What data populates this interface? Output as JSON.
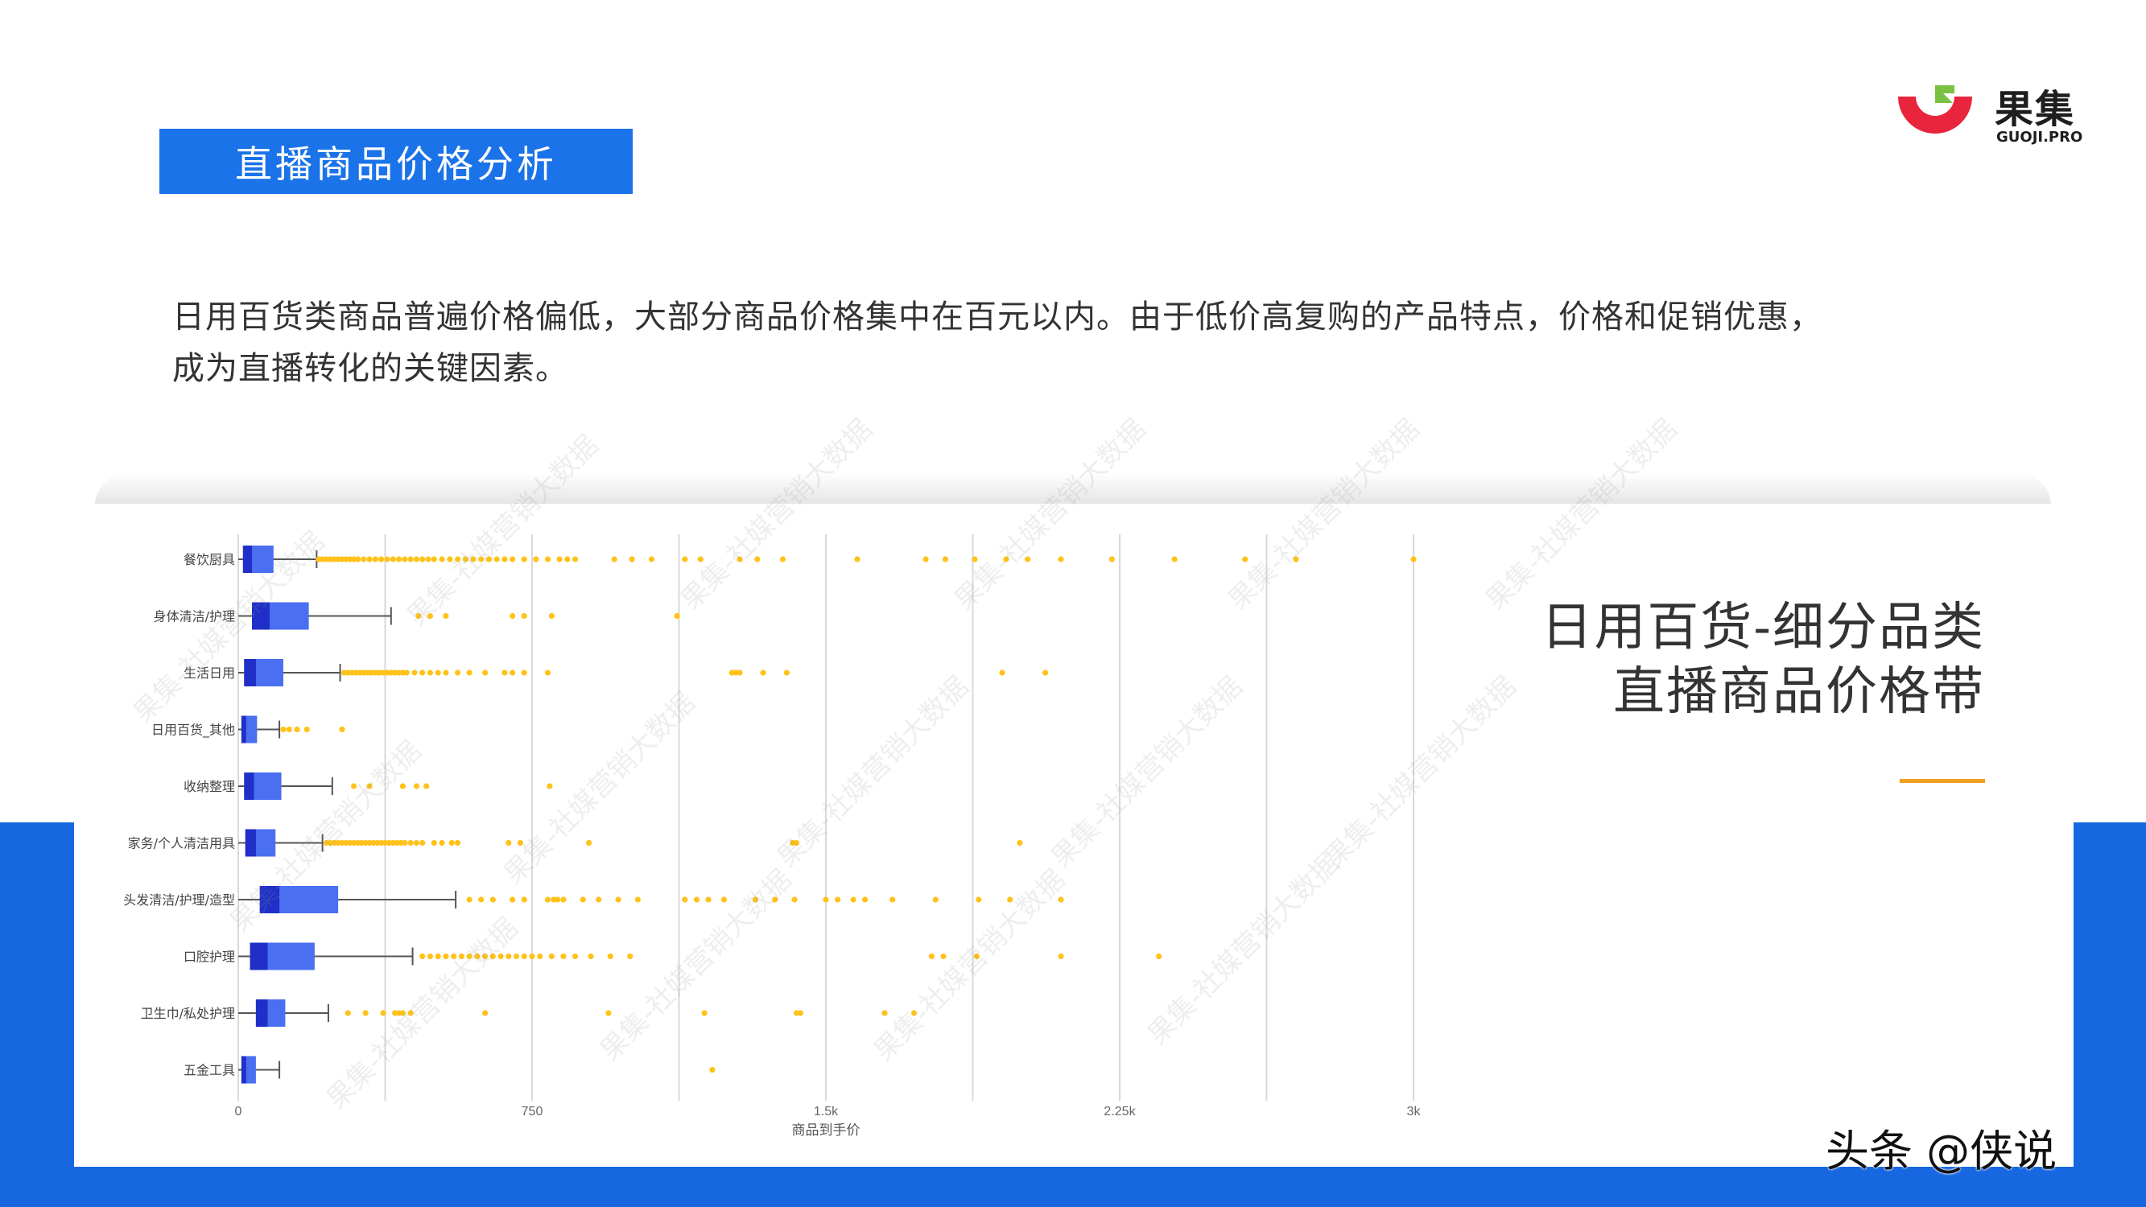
{
  "header": {
    "title": "直播商品价格分析",
    "logo_name": "果集",
    "logo_sub": "GUOJI.PRO"
  },
  "body": {
    "line1": "日用百货类商品普遍价格偏低，大部分商品价格集中在百元以内。由于低价高复购的产品特点，价格和促销优惠，",
    "line2": "成为直播转化的关键因素。"
  },
  "side": {
    "line1": "日用百货-细分品类",
    "line2": "直播商品价格带"
  },
  "footer": {
    "mark": "头条 @侠说"
  },
  "colors": {
    "blue": "#1a73e8",
    "box_fill": "#4a6ff0",
    "median": "#1f2fc8",
    "outlier": "#ffc21a",
    "accent": "#f0a020"
  },
  "chart_data": {
    "type": "box",
    "orientation": "horizontal",
    "xlabel": "商品到手价",
    "xlim": [
      0,
      3000
    ],
    "xticks": [
      0,
      750,
      1500,
      2250,
      3000
    ],
    "xtick_labels": [
      "0",
      "750",
      "1.5k",
      "2.25k",
      "3k"
    ],
    "grid": true,
    "categories": [
      "餐饮厨具",
      "身体清洁/护理",
      "生活日用",
      "日用百货_其他",
      "收纳整理",
      "家务/个人清洁用具",
      "头发清洁/护理/造型",
      "口腔护理",
      "卫生巾/私处护理",
      "五金工具"
    ],
    "boxes": [
      {
        "min": 0,
        "q1": 12,
        "median": 35,
        "q3": 90,
        "max": 200,
        "outliers": [
          205,
          215,
          225,
          235,
          245,
          255,
          265,
          275,
          285,
          295,
          305,
          320,
          335,
          350,
          365,
          380,
          395,
          410,
          425,
          440,
          455,
          470,
          485,
          500,
          520,
          540,
          560,
          580,
          600,
          620,
          640,
          660,
          680,
          700,
          730,
          760,
          790,
          820,
          840,
          860,
          960,
          1005,
          1055,
          1140,
          1180,
          1280,
          1325,
          1390,
          1580,
          1755,
          1805,
          1880,
          1960,
          2015,
          2100,
          2230,
          2390,
          2570,
          2700,
          3000
        ]
      },
      {
        "min": 0,
        "q1": 35,
        "median": 80,
        "q3": 180,
        "max": 390,
        "outliers": [
          460,
          490,
          530,
          700,
          730,
          800,
          1120
        ]
      },
      {
        "min": 0,
        "q1": 15,
        "median": 45,
        "q3": 115,
        "max": 260,
        "outliers": [
          270,
          280,
          290,
          300,
          310,
          320,
          330,
          340,
          350,
          360,
          370,
          380,
          390,
          400,
          410,
          420,
          430,
          450,
          470,
          490,
          510,
          530,
          560,
          590,
          630,
          680,
          700,
          730,
          790,
          1260,
          1270,
          1280,
          1340,
          1400,
          1950,
          2060
        ]
      },
      {
        "min": 0,
        "q1": 8,
        "median": 20,
        "q3": 48,
        "max": 105,
        "outliers": [
          115,
          130,
          150,
          175,
          265
        ]
      },
      {
        "min": 0,
        "q1": 15,
        "median": 40,
        "q3": 110,
        "max": 240,
        "outliers": [
          295,
          335,
          420,
          455,
          480,
          795
        ]
      },
      {
        "min": 0,
        "q1": 18,
        "median": 45,
        "q3": 95,
        "max": 215,
        "outliers": [
          225,
          235,
          245,
          255,
          265,
          275,
          285,
          295,
          305,
          315,
          325,
          335,
          345,
          355,
          365,
          375,
          385,
          395,
          405,
          415,
          425,
          440,
          455,
          470,
          500,
          520,
          545,
          560,
          690,
          720,
          895,
          1415,
          1425,
          1995
        ]
      },
      {
        "min": 0,
        "q1": 55,
        "median": 105,
        "q3": 255,
        "max": 555,
        "outliers": [
          590,
          620,
          650,
          700,
          730,
          790,
          805,
          815,
          830,
          880,
          920,
          970,
          1020,
          1140,
          1170,
          1200,
          1240,
          1320,
          1370,
          1420,
          1500,
          1530,
          1570,
          1600,
          1670,
          1780,
          1890,
          1970,
          2100
        ]
      },
      {
        "min": 0,
        "q1": 30,
        "median": 75,
        "q3": 195,
        "max": 445,
        "outliers": [
          470,
          490,
          510,
          530,
          550,
          570,
          590,
          610,
          630,
          650,
          670,
          690,
          710,
          730,
          750,
          770,
          800,
          830,
          860,
          900,
          950,
          1000,
          1770,
          1800,
          1885,
          2100,
          2350
        ]
      },
      {
        "min": 0,
        "q1": 45,
        "median": 75,
        "q3": 120,
        "max": 230,
        "outliers": [
          280,
          325,
          370,
          400,
          410,
          420,
          440,
          630,
          945,
          1190,
          1425,
          1435,
          1650,
          1725
        ]
      },
      {
        "min": 0,
        "q1": 8,
        "median": 20,
        "q3": 45,
        "max": 105,
        "outliers": [
          1210
        ]
      }
    ]
  }
}
